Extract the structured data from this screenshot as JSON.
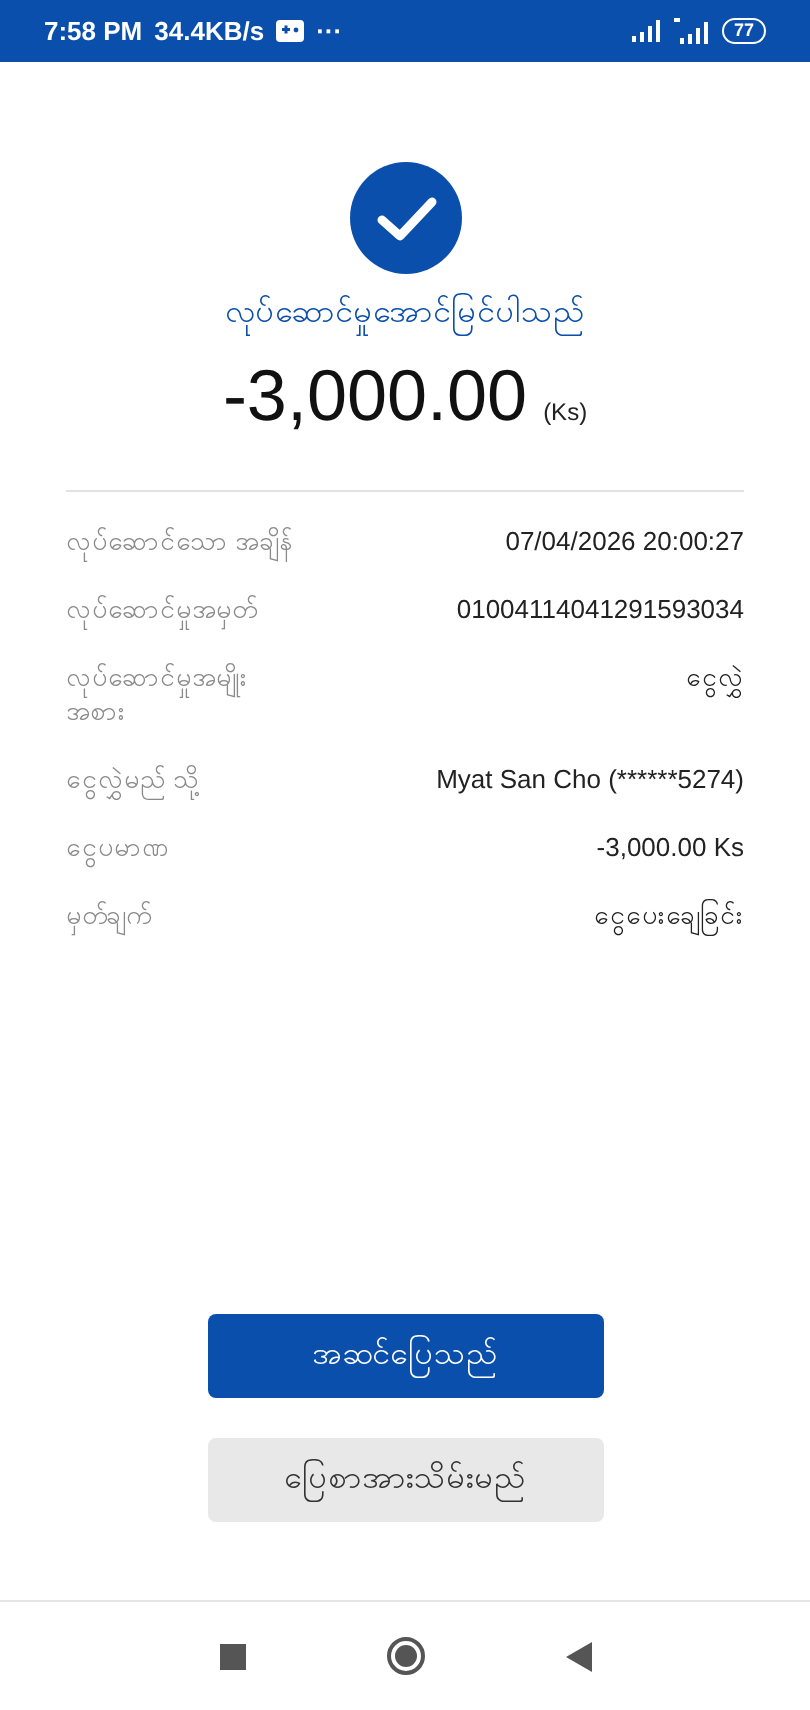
{
  "status_bar": {
    "time": "7:58 PM",
    "speed": "34.4KB/s",
    "more": "···",
    "battery": "77"
  },
  "result": {
    "title": "လုပ်ဆောင်မှုအောင်မြင်ပါသည်",
    "amount": "-3,000.00",
    "currency": "(Ks)"
  },
  "details": [
    {
      "label": "လုပ်ဆောင်သော အချိန်",
      "value": "07/04/2026 20:00:27"
    },
    {
      "label": "လုပ်ဆောင်မှုအမှတ်",
      "value": "01004114041291593034"
    },
    {
      "label": "လုပ်ဆောင်မှုအမျိုးအစား",
      "value": "ငွေလွှဲ"
    },
    {
      "label": "ငွေလွှဲမည် သို့",
      "value": "Myat San Cho (******5274)"
    },
    {
      "label": "ငွေပမာဏ",
      "value": "-3,000.00 Ks"
    },
    {
      "label": "မှတ်ချက်",
      "value": "ငွေပေးချေခြင်း"
    }
  ],
  "buttons": [
    {
      "label": "အဆင်ပြေသည်",
      "kind": "primary"
    },
    {
      "label": "ပြေစာအားသိမ်းမည်",
      "kind": "secondary"
    }
  ]
}
